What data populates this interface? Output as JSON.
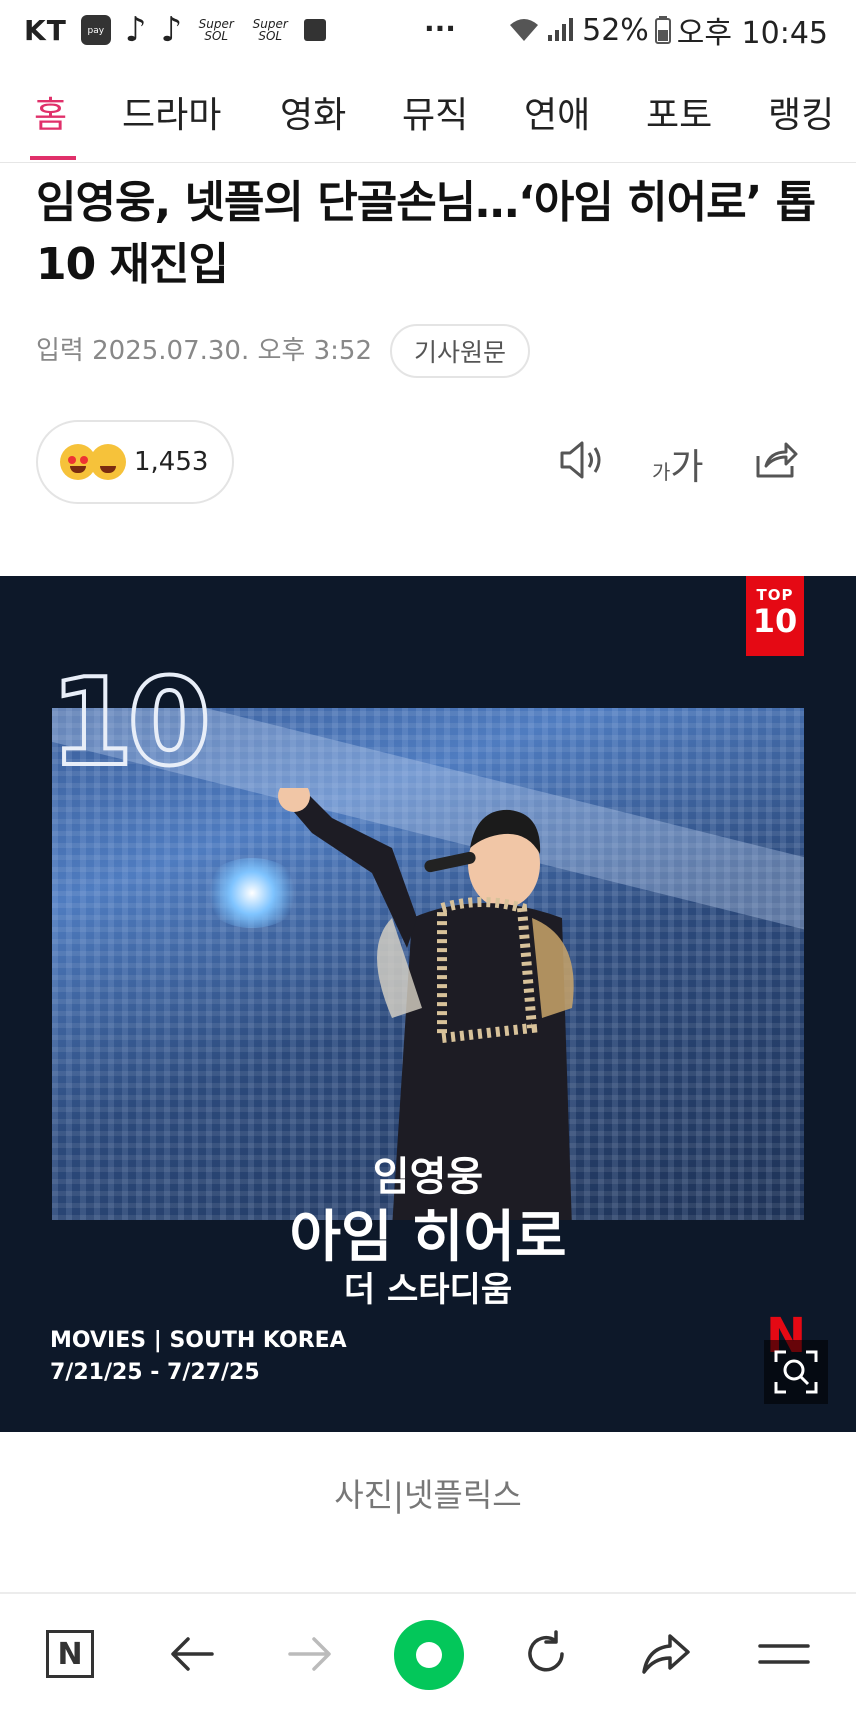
{
  "status_bar": {
    "carrier": "KT",
    "pay_label": "pay",
    "super_sol_1": "Super SOL",
    "super_sol_2": "Super SOL",
    "more": "···",
    "battery": "52%",
    "time": "오후 10:45"
  },
  "tabs": [
    {
      "label": "홈",
      "active": true
    },
    {
      "label": "드라마"
    },
    {
      "label": "영화"
    },
    {
      "label": "뮤직"
    },
    {
      "label": "연애"
    },
    {
      "label": "포토"
    },
    {
      "label": "랭킹"
    }
  ],
  "article": {
    "headline": "임영웅, 넷플의 단골손님…‘아임 히어로’ 톱10 재진입",
    "input_label": "입력",
    "date": "2025.07.30. 오후 3:52",
    "original_button": "기사원문",
    "reaction_count": "1,453",
    "font_small": "가",
    "font_big": "가",
    "caption": "사진|넷플릭스"
  },
  "photo": {
    "badge_top": "TOP",
    "badge_num": "10",
    "big_number": "10",
    "title_line1": "임영웅",
    "title_line2": "아임 히어로",
    "title_line3": "더 스타디움",
    "category": "MOVIES | SOUTH KOREA",
    "dates": "7/21/25 - 7/27/25",
    "netflix_logo": "N"
  },
  "colors": {
    "accent": "#e0306a",
    "netflix_red": "#e50914",
    "refresh_green": "#03c75a"
  },
  "bottom_nav": {
    "home_label": "N"
  }
}
